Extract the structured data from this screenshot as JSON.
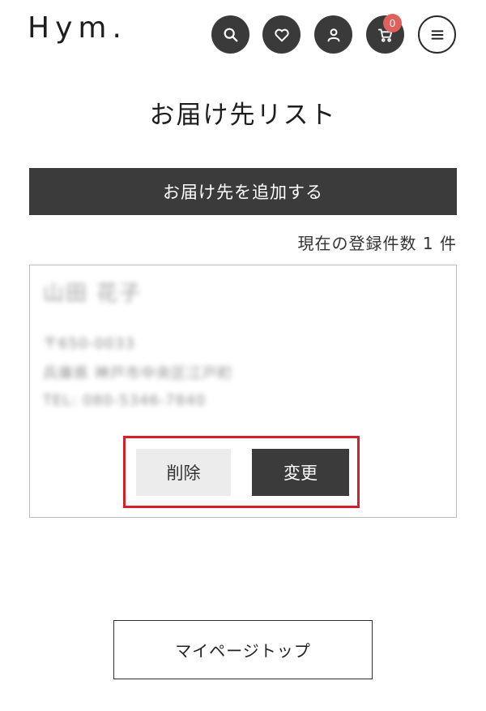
{
  "header": {
    "logo": "Hym.",
    "cart_count": "0",
    "icons": [
      "search-icon",
      "heart-icon",
      "user-icon",
      "cart-icon",
      "menu-icon"
    ]
  },
  "page_title": "お届け先リスト",
  "add_button_label": "お届け先を追加する",
  "registered_count_text": "現在の登録件数 1 件",
  "address": {
    "name": "山田 花子",
    "postal": "〒650-0033",
    "address_line": "兵庫県 神戸市中央区江戸町",
    "phone": "TEL: 080-5346-7840"
  },
  "card_actions": {
    "delete_label": "削除",
    "edit_label": "変更"
  },
  "mypage_button_label": "マイページトップ",
  "colors": {
    "dark": "#3b3b3b",
    "badge": "#e0605e",
    "highlight": "#d3212b",
    "delete_bg": "#ececec"
  }
}
